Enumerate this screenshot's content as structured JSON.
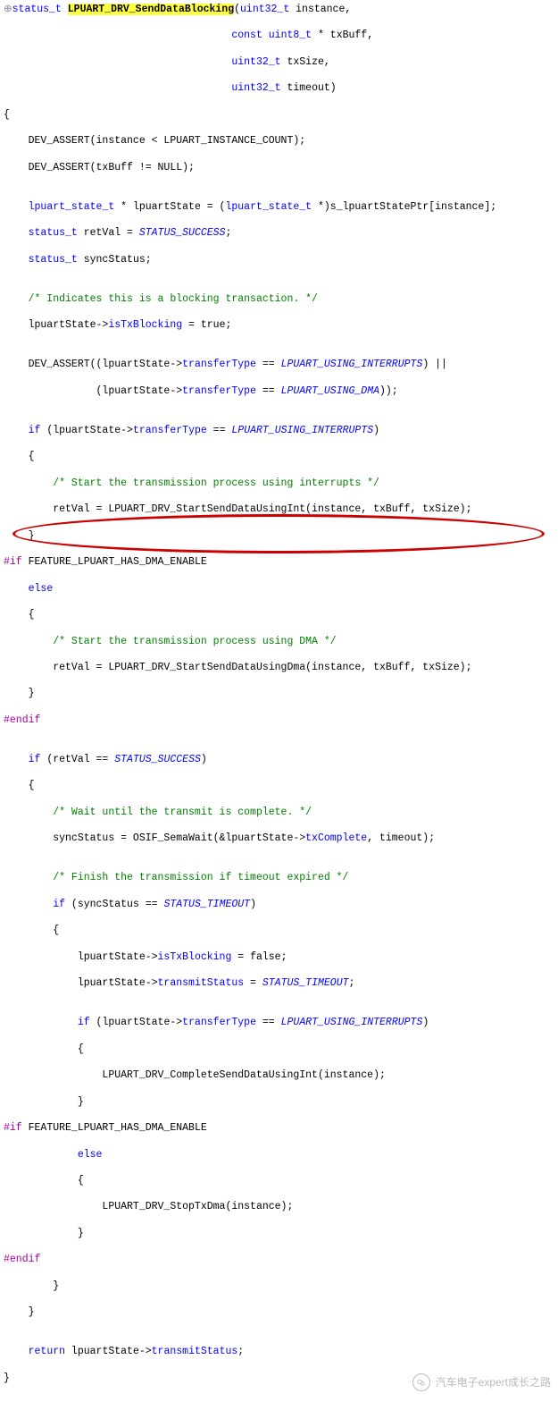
{
  "sig": {
    "exp": "⊕",
    "ret": "status_t",
    "name": "LPUART_DRV_SendDataBlocking",
    "p1t": "uint32_t",
    "p1n": "instance,",
    "p2a": "const",
    "p2t": "uint8_t",
    "p2n": "* txBuff,",
    "p3t": "uint32_t",
    "p3n": "txSize,",
    "p4t": "uint32_t",
    "p4n": "timeout)"
  },
  "b": {
    "ob": "{",
    "a1": "    DEV_ASSERT(instance < LPUART_INSTANCE_COUNT);",
    "a2": "    DEV_ASSERT(txBuff != NULL);",
    "l3a": "    ",
    "l3t": "lpuart_state_t",
    "l3b": " * lpuartState = (",
    "l3t2": "lpuart_state_t",
    "l3c": " *)s_lpuartStatePtr[instance];",
    "l4a": "    ",
    "l4t": "status_t",
    "l4b": " retVal = ",
    "l4e": "STATUS_SUCCESS",
    "l4c": ";",
    "l5a": "    ",
    "l5t": "status_t",
    "l5b": " syncStatus;",
    "c1": "    /* Indicates this is a blocking transaction. */",
    "l6a": "    lpuartState->",
    "l6m": "isTxBlocking",
    "l6b": " = true;",
    "l7a": "    DEV_ASSERT((lpuartState->",
    "l7m": "transferType",
    "l7b": " == ",
    "l7e": "LPUART_USING_INTERRUPTS",
    "l7c": ") ||",
    "l8a": "               (lpuartState->",
    "l8m": "transferType",
    "l8b": " == ",
    "l8e": "LPUART_USING_DMA",
    "l8c": "));",
    "l9a": "    ",
    "l9k": "if",
    "l9b": " (lpuartState->",
    "l9m": "transferType",
    "l9c": " == ",
    "l9e": "LPUART_USING_INTERRUPTS",
    "l9d": ")",
    "l10": "    {",
    "c2": "        /* Start the transmission process using interrupts */",
    "l11": "        retVal = LPUART_DRV_StartSendDataUsingInt(instance, txBuff, txSize);",
    "l12": "    }",
    "m1": "#if",
    "m1b": " FEATURE_LPUART_HAS_DMA_ENABLE",
    "l13a": "    ",
    "l13k": "else",
    "l14": "    {",
    "c3": "        /* Start the transmission process using DMA */",
    "l15": "        retVal = LPUART_DRV_StartSendDataUsingDma(instance, txBuff, txSize);",
    "l16": "    }",
    "m2": "#endif",
    "l17a": "    ",
    "l17k": "if",
    "l17b": " (retVal == ",
    "l17e": "STATUS_SUCCESS",
    "l17c": ")",
    "l18": "    {",
    "c4": "        /* Wait until the transmit is complete. */",
    "l19a": "        syncStatus = OSIF_SemaWait(&lpuartState->",
    "l19m": "txComplete",
    "l19b": ", timeout);",
    "c5": "        /* Finish the transmission if timeout expired */",
    "l20a": "        ",
    "l20k": "if",
    "l20b": " (syncStatus == ",
    "l20e": "STATUS_TIMEOUT",
    "l20c": ")",
    "l21": "        {",
    "l22a": "            lpuartState->",
    "l22m": "isTxBlocking",
    "l22b": " = false;",
    "l23a": "            lpuartState->",
    "l23m": "transmitStatus",
    "l23b": " = ",
    "l23e": "STATUS_TIMEOUT",
    "l23c": ";",
    "l24a": "            ",
    "l24k": "if",
    "l24b": " (lpuartState->",
    "l24m": "transferType",
    "l24c": " == ",
    "l24e": "LPUART_USING_INTERRUPTS",
    "l24d": ")",
    "l25": "            {",
    "l26": "                LPUART_DRV_CompleteSendDataUsingInt(instance);",
    "l27": "            }",
    "m3": "#if",
    "m3b": " FEATURE_LPUART_HAS_DMA_ENABLE",
    "l28a": "            ",
    "l28k": "else",
    "l29": "            {",
    "l30": "                LPUART_DRV_StopTxDma(instance);",
    "l31": "            }",
    "m4": "#endif",
    "l32": "        }",
    "l33": "    }",
    "l34a": "    ",
    "l34k": "return",
    "l34b": " lpuartState->",
    "l34m": "transmitStatus",
    "l34c": ";",
    "cb": "}"
  },
  "wm": "汽车电子expert成长之路"
}
